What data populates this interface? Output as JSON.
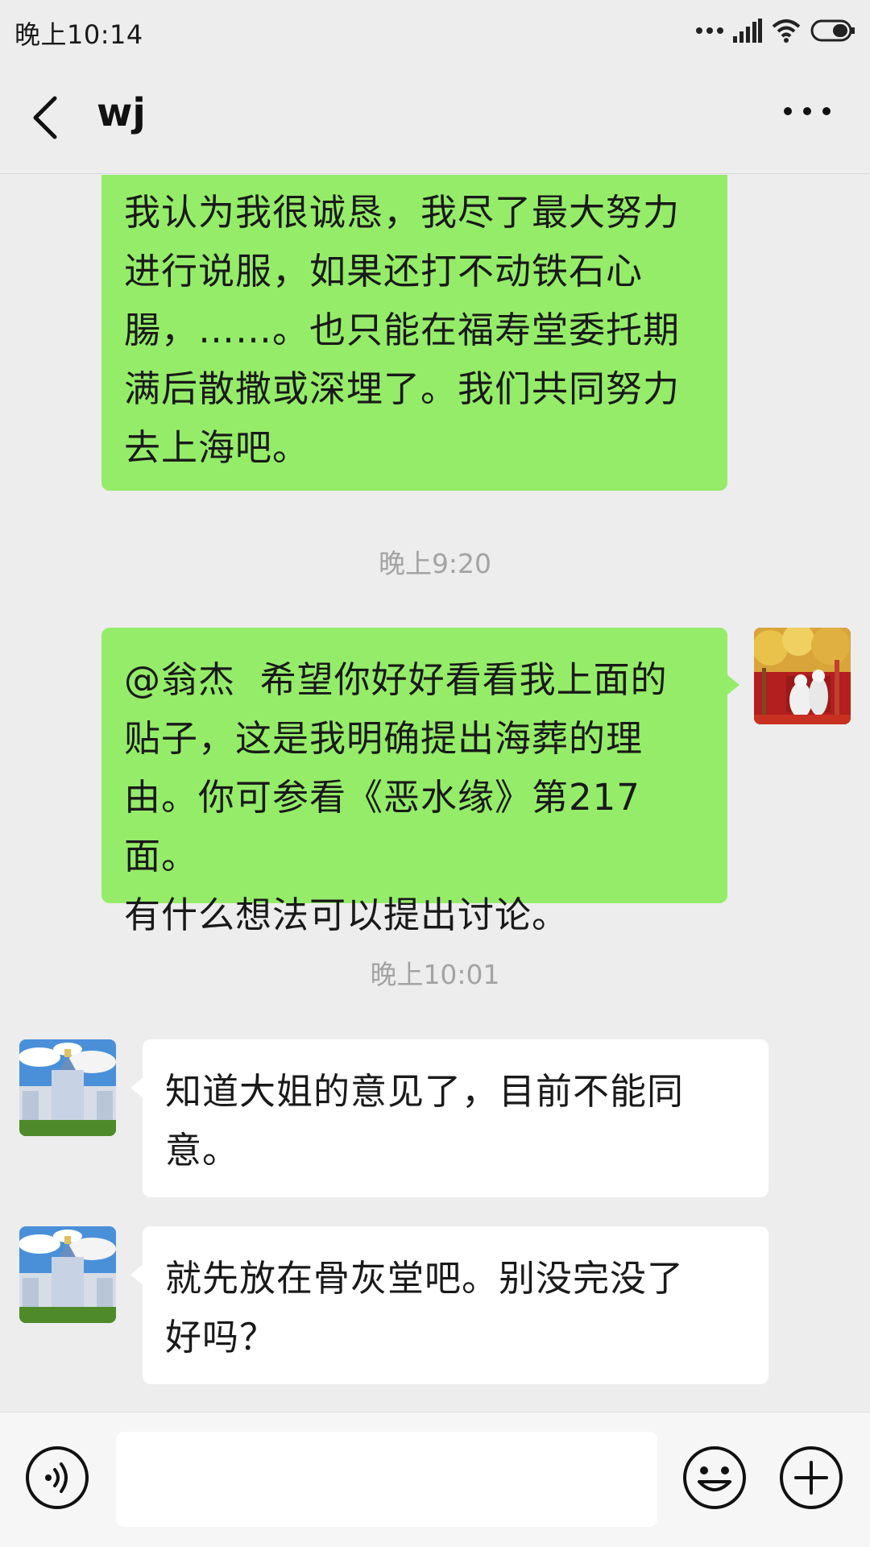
{
  "status_bar": {
    "time": "晚上10:14"
  },
  "header": {
    "title": "wj",
    "back_icon": "chevron-left-icon",
    "more_icon": "more-horizontal-icon"
  },
  "messages": [
    {
      "type": "sent",
      "text": "我认为我很诚恳，我尽了最大努力\n进行说服，如果还打不动铁石心\n腸，……。也只能在福寿堂委托期\n满后散撒或深埋了。我们共同努力\n去上海吧。"
    },
    {
      "type": "time",
      "text": "晚上9:20"
    },
    {
      "type": "sent",
      "text": "@翁杰  希望你好好看看我上面的\n贴子，这是我明确提出海葬的理\n由。你可参看《恶水缘》第217面。\n有什么想法可以提出讨论。"
    },
    {
      "type": "time",
      "text": "晚上10:01"
    },
    {
      "type": "received",
      "text": "知道大姐的意见了，目前不能同\n意。"
    },
    {
      "type": "received",
      "text": "就先放在骨灰堂吧。别没完没了\n好吗？"
    }
  ],
  "input_bar": {
    "placeholder": "",
    "value": "",
    "voice_icon": "voice-icon",
    "emoji_icon": "emoji-icon",
    "plus_icon": "plus-icon"
  },
  "colors": {
    "background": "#ededed",
    "sent_bubble": "#95ec69",
    "received_bubble": "#ffffff",
    "timestamp": "#a3a3a3"
  }
}
